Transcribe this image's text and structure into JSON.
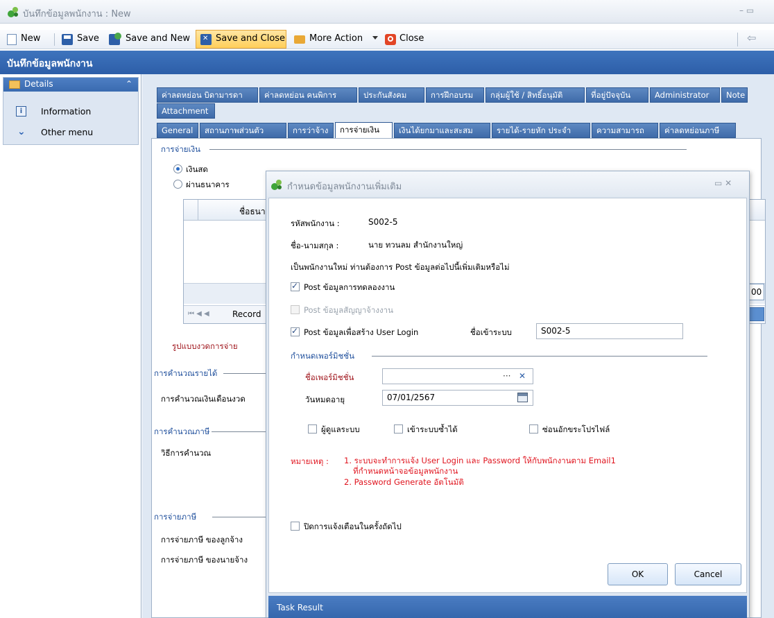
{
  "window": {
    "title": "บันทึกข้อมูลพนักงาน : New",
    "win_controls": "–  ▭"
  },
  "toolbar": {
    "new": "New",
    "save": "Save",
    "save_new": "Save and New",
    "save_close": "Save and Close",
    "more_action": "More Action",
    "close": "Close",
    "back_arrow": "⇦"
  },
  "page_header": "บันทึกข้อมูลพนักงาน",
  "sidebar": {
    "header": "Details",
    "collapse": "⌃",
    "items": [
      {
        "label": "Information",
        "icon": "info-icon"
      },
      {
        "label": "Other menu",
        "icon": "chevron-double-down-icon"
      }
    ]
  },
  "tabs": {
    "row1": [
      "ค่าลดหย่อน บิดามารดา",
      "ค่าลดหย่อน คนพิการ",
      "ประกันสังคม",
      "การฝึกอบรม",
      "กลุ่มผู้ใช้ / สิทธิ์อนุมัติ",
      "ที่อยู่ปัจจุบัน",
      "Administrator",
      "Note"
    ],
    "row2": [
      "Attachment"
    ],
    "row3": [
      "General",
      "สถานภาพส่วนตัว",
      "การว่าจ้าง",
      "การจ่ายเงิน",
      "เงินได้ยกมาและสะสม",
      "รายได้-รายหัก ประจำ",
      "ความสามารถ",
      "ค่าลดหย่อนภาษี"
    ],
    "active": "การจ่ายเงิน"
  },
  "payment": {
    "group": "การจ่ายเงิน",
    "cash": "เงินสด",
    "bank": "ผ่านธนาคาร",
    "grid_col": "ชื่อธนา",
    "pager": "Record",
    "pager_nav": "⏮ ◀ ◀",
    "cut_value": "00",
    "pay_period": "รูปแบบงวดการจ่าย",
    "income_calc_group": "การคำนวณรายได้",
    "salary_calc": "การคำนวณเงินเดือนงวด",
    "tax_calc_group": "การคำนวณภาษี",
    "calc_method": "วิธีการคำนวณ",
    "tax_pay_group": "การจ่ายภาษี",
    "tax_employee": "การจ่ายภาษี ของลูกจ้าง",
    "tax_employer": "การจ่ายภาษี ของนายจ้าง"
  },
  "dialog": {
    "title": "กำหนดข้อมูลพนักงานเพิ่มเติม",
    "controls": "▭  ✕",
    "emp_code_label": "รหัสพนักงาน :",
    "emp_code": "S002-5",
    "name_label": "ชื่อ-นามสกุล :",
    "name": "นาย ทวนลม สำนักงานใหญ่",
    "question": "เป็นพนักงานใหม่ ท่านต้องการ Post ข้อมูลต่อไปนี้เพิ่มเติมหรือไม่",
    "post_probation": "Post ข้อมูลการทดลองงาน",
    "post_contract": "Post ข้อมูลสัญญาจ้างงาน",
    "post_login": "Post ข้อมูลเพื่อสร้าง User Login",
    "login_label": "ชื่อเข้าระบบ",
    "login_value": "S002-5",
    "perm_group": "กำหนดเพอร์มิชชั่น",
    "perm_name_label": "ชื่อเพอร์มิชชั่น",
    "perm_name_value": "",
    "perm_dots": "···",
    "perm_clear": "✕",
    "expire_label": "วันหมดอายุ",
    "expire_value": "07/01/2567",
    "cb_admin": "ผู้ดูแลระบบ",
    "cb_relogin": "เข้าระบบซ้ำได้",
    "cb_hide": "ซ่อนอักขระโปรไฟล์",
    "note_label": "หมายเหตุ :",
    "note1": "1. ระบบจะทำการแจ้ง User Login และ Password ให้กับพนักงานตาม Email1",
    "note1b": "ที่กำหนดหน้าจอข้อมูลพนักงาน",
    "note2": "2. Password Generate อัตโนมัติ",
    "cb_disable_notify": "ปิดการแจ้งเตือนในครั้งถัดไป",
    "ok": "OK",
    "cancel": "Cancel",
    "task_result": "Task Result"
  },
  "colors": {
    "accent": "#3b6fb6",
    "note_red": "#e0141e",
    "header_blue": "#3567ad"
  }
}
